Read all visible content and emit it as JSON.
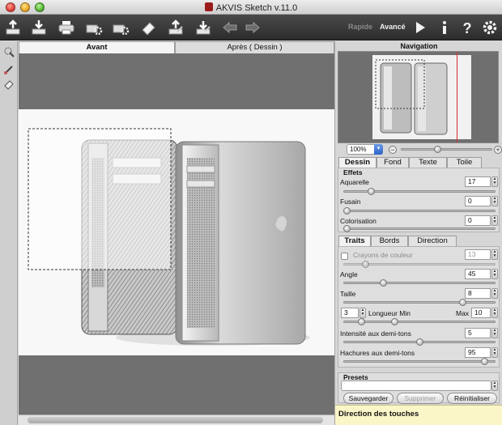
{
  "window": {
    "title": "AKVIS Sketch v.11.0"
  },
  "toolbar": {
    "buttons": [
      {
        "name": "open-image-button",
        "icon": "open-icon"
      },
      {
        "name": "save-image-button",
        "icon": "save-icon"
      },
      {
        "name": "print-button",
        "icon": "print-icon"
      },
      {
        "name": "batch-processing-button",
        "icon": "batch-icon"
      },
      {
        "name": "preferences-button",
        "icon": "gear-printer-icon"
      },
      {
        "name": "erase-button",
        "icon": "eraser-icon"
      },
      {
        "name": "share-button",
        "icon": "upload-icon"
      },
      {
        "name": "export-button",
        "icon": "export-icon"
      },
      {
        "name": "undo-button",
        "icon": "arrow-left-icon"
      },
      {
        "name": "redo-button",
        "icon": "arrow-right-icon"
      }
    ],
    "mode_rapide": "Rapide",
    "mode_avance": "Avancé",
    "right_buttons": [
      "run-icon",
      "info-icon",
      "help-icon",
      "settings-icon"
    ]
  },
  "canvas": {
    "tab_before": "Avant",
    "tab_after": "Après ( Dessin )"
  },
  "navigation": {
    "title": "Navigation",
    "zoom": "100%"
  },
  "main_tabs": [
    "Dessin",
    "Fond",
    "Texte",
    "Toile"
  ],
  "effets": {
    "title": "Effets",
    "aquarelle": {
      "label": "Aquarelle",
      "value": "17",
      "level": 0.17
    },
    "fusain": {
      "label": "Fusain",
      "value": "0",
      "level": 0
    },
    "colorisation": {
      "label": "Colorisation",
      "value": "0",
      "level": 0
    }
  },
  "sub_tabs": [
    "Traits",
    "Bords",
    "Direction"
  ],
  "traits": {
    "crayons": {
      "label": "Crayons de couleur",
      "value": "13",
      "checked": false,
      "level": 0.13
    },
    "angle": {
      "label": "Angle",
      "value": "45",
      "level": 0.25
    },
    "taille": {
      "label": "Taille",
      "value": "8",
      "level": 0.8
    },
    "longueur": {
      "label": "Longueur Min",
      "min_value": "3",
      "max_label": "Max",
      "max_value": "10",
      "level_min": 0.1,
      "level_max": 0.33
    },
    "intensite": {
      "label": "Intensité aux demi-tons",
      "value": "5",
      "level": 0.5
    },
    "hachures": {
      "label": "Hachures aux demi-tons",
      "value": "95",
      "level": 0.95
    }
  },
  "presets": {
    "title": "Presets",
    "selected": "",
    "save": "Sauvegarder",
    "delete": "Supprimer",
    "reset": "Réinitialiser"
  },
  "tip": {
    "title": "Direction des touches"
  }
}
